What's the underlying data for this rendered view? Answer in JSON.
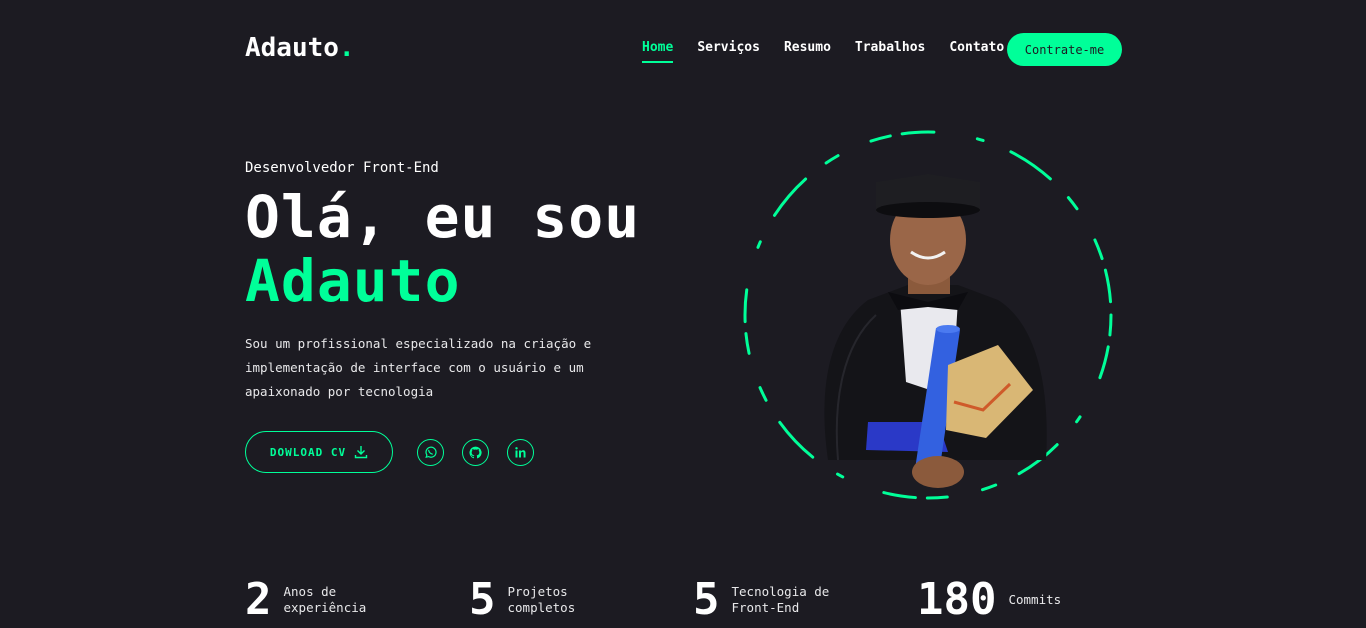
{
  "logo": {
    "text": "Adauto",
    "dot": "."
  },
  "nav": {
    "items": [
      {
        "label": "Home",
        "active": true
      },
      {
        "label": "Serviços",
        "active": false
      },
      {
        "label": "Resumo",
        "active": false
      },
      {
        "label": "Trabalhos",
        "active": false
      },
      {
        "label": "Contato",
        "active": false
      }
    ],
    "cta": "Contrate-me"
  },
  "hero": {
    "role": "Desenvolvedor Front-End",
    "greeting": "Olá, eu sou",
    "name": "Adauto",
    "description": "Sou um profissional especializado na criação e implementação de interface com o usuário e um apaixonado por tecnologia",
    "download": "DOWLOAD CV",
    "social": [
      "whatsapp-icon",
      "github-icon",
      "linkedin-icon"
    ]
  },
  "stats": [
    {
      "num": "2",
      "l1": "Anos de",
      "l2": "experiência"
    },
    {
      "num": "5",
      "l1": "Projetos",
      "l2": "completos"
    },
    {
      "num": "5",
      "l1": "Tecnologia de",
      "l2": "Front-End"
    },
    {
      "num": "180",
      "l1": "Commits",
      "l2": ""
    }
  ],
  "colors": {
    "accent": "#00ff99",
    "background": "#1c1b22"
  }
}
